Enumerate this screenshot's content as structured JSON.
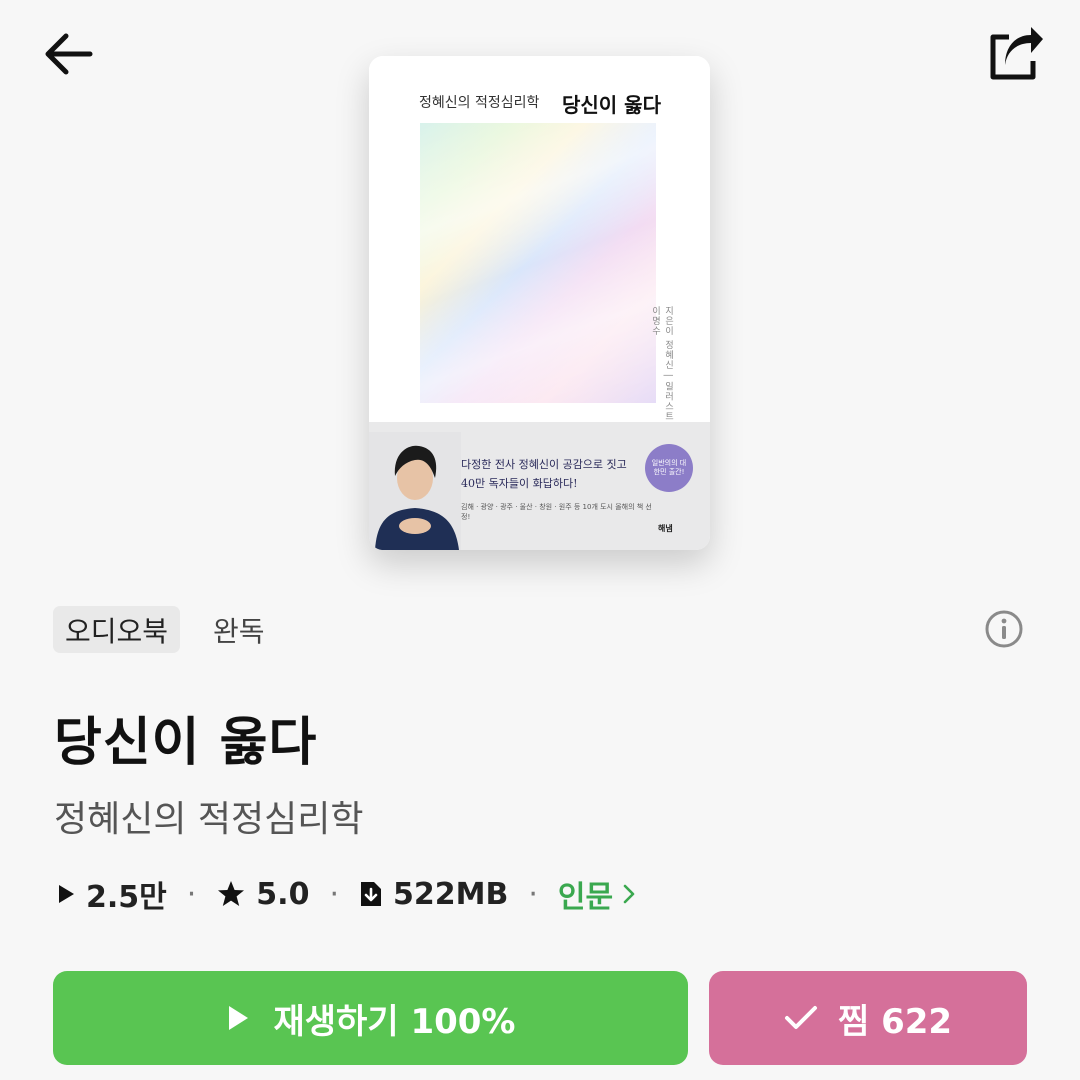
{
  "header": {
    "back_icon": "arrow-left-icon",
    "share_icon": "share-icon"
  },
  "cover": {
    "subtitle": "정혜신의 적정심리학",
    "title": "당신이 옳다",
    "vertical_text": "지은이 정혜신 | 일러스트 이명수",
    "blurb_line1": "다정한 전사 정혜신이 공감으로 짓고",
    "blurb_line2": "40만 독자들이 화답하다!",
    "blurb_small": "김해 · 광양 · 광주 · 울산 · 창원 · 원주 등 10개 도시 올해의 책 선정!",
    "badge": "일반의의 대한민 출간!",
    "publisher": "해냄"
  },
  "meta": {
    "type_tag": "오디오북",
    "status": "완독",
    "info_icon": "info-icon"
  },
  "book": {
    "title": "당신이 옳다",
    "subtitle": "정혜신의 적정심리학"
  },
  "stats": {
    "plays": "2.5만",
    "rating": "5.0",
    "size": "522MB",
    "category": "인문",
    "separator": "·"
  },
  "actions": {
    "play_label": "재생하기 100%",
    "wish_label": "찜 622"
  },
  "colors": {
    "play_button": "#59c552",
    "wish_button": "#d5709a",
    "category_link": "#3aa84f",
    "background": "#f7f7f7"
  }
}
